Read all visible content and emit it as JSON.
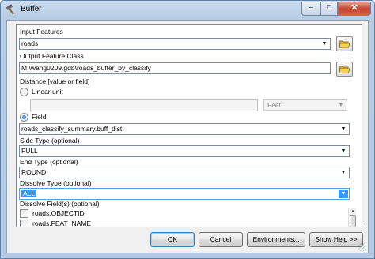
{
  "window": {
    "title": "Buffer",
    "minimize_glyph": "–",
    "maximize_glyph": "□",
    "close_glyph": "✕",
    "icon": "hammer-tool-icon"
  },
  "form": {
    "input_features": {
      "label": "Input Features",
      "value": "roads"
    },
    "output_feature_class": {
      "label": "Output Feature Class",
      "value": "M:\\wang0209.gdb\\roads_buffer_by_classify"
    },
    "distance": {
      "label": "Distance [value or field]",
      "linear_unit_label": "Linear unit",
      "linear_unit_value": "",
      "unit_value": "Feet",
      "field_label": "Field",
      "field_value": "roads_classify_summary.buff_dist",
      "selected_option": "Field"
    },
    "side_type": {
      "label": "Side Type (optional)",
      "value": "FULL"
    },
    "end_type": {
      "label": "End Type (optional)",
      "value": "ROUND"
    },
    "dissolve_type": {
      "label": "Dissolve Type (optional)",
      "value": "ALL"
    },
    "dissolve_fields": {
      "label": "Dissolve Field(s) (optional)",
      "items": [
        {
          "label": "roads.OBJECTID",
          "checked": false
        },
        {
          "label": "roads.FEAT_NAME",
          "checked": false
        }
      ]
    }
  },
  "buttons": {
    "ok": "OK",
    "cancel": "Cancel",
    "environments": "Environments...",
    "show_help": "Show Help >>"
  },
  "icons": {
    "browse": "folder-open-icon",
    "dropdown": "chevron-down-icon"
  },
  "colors": {
    "selection": "#3399ff",
    "window_frame": "#b8cde4",
    "close_button": "#c6432d"
  }
}
